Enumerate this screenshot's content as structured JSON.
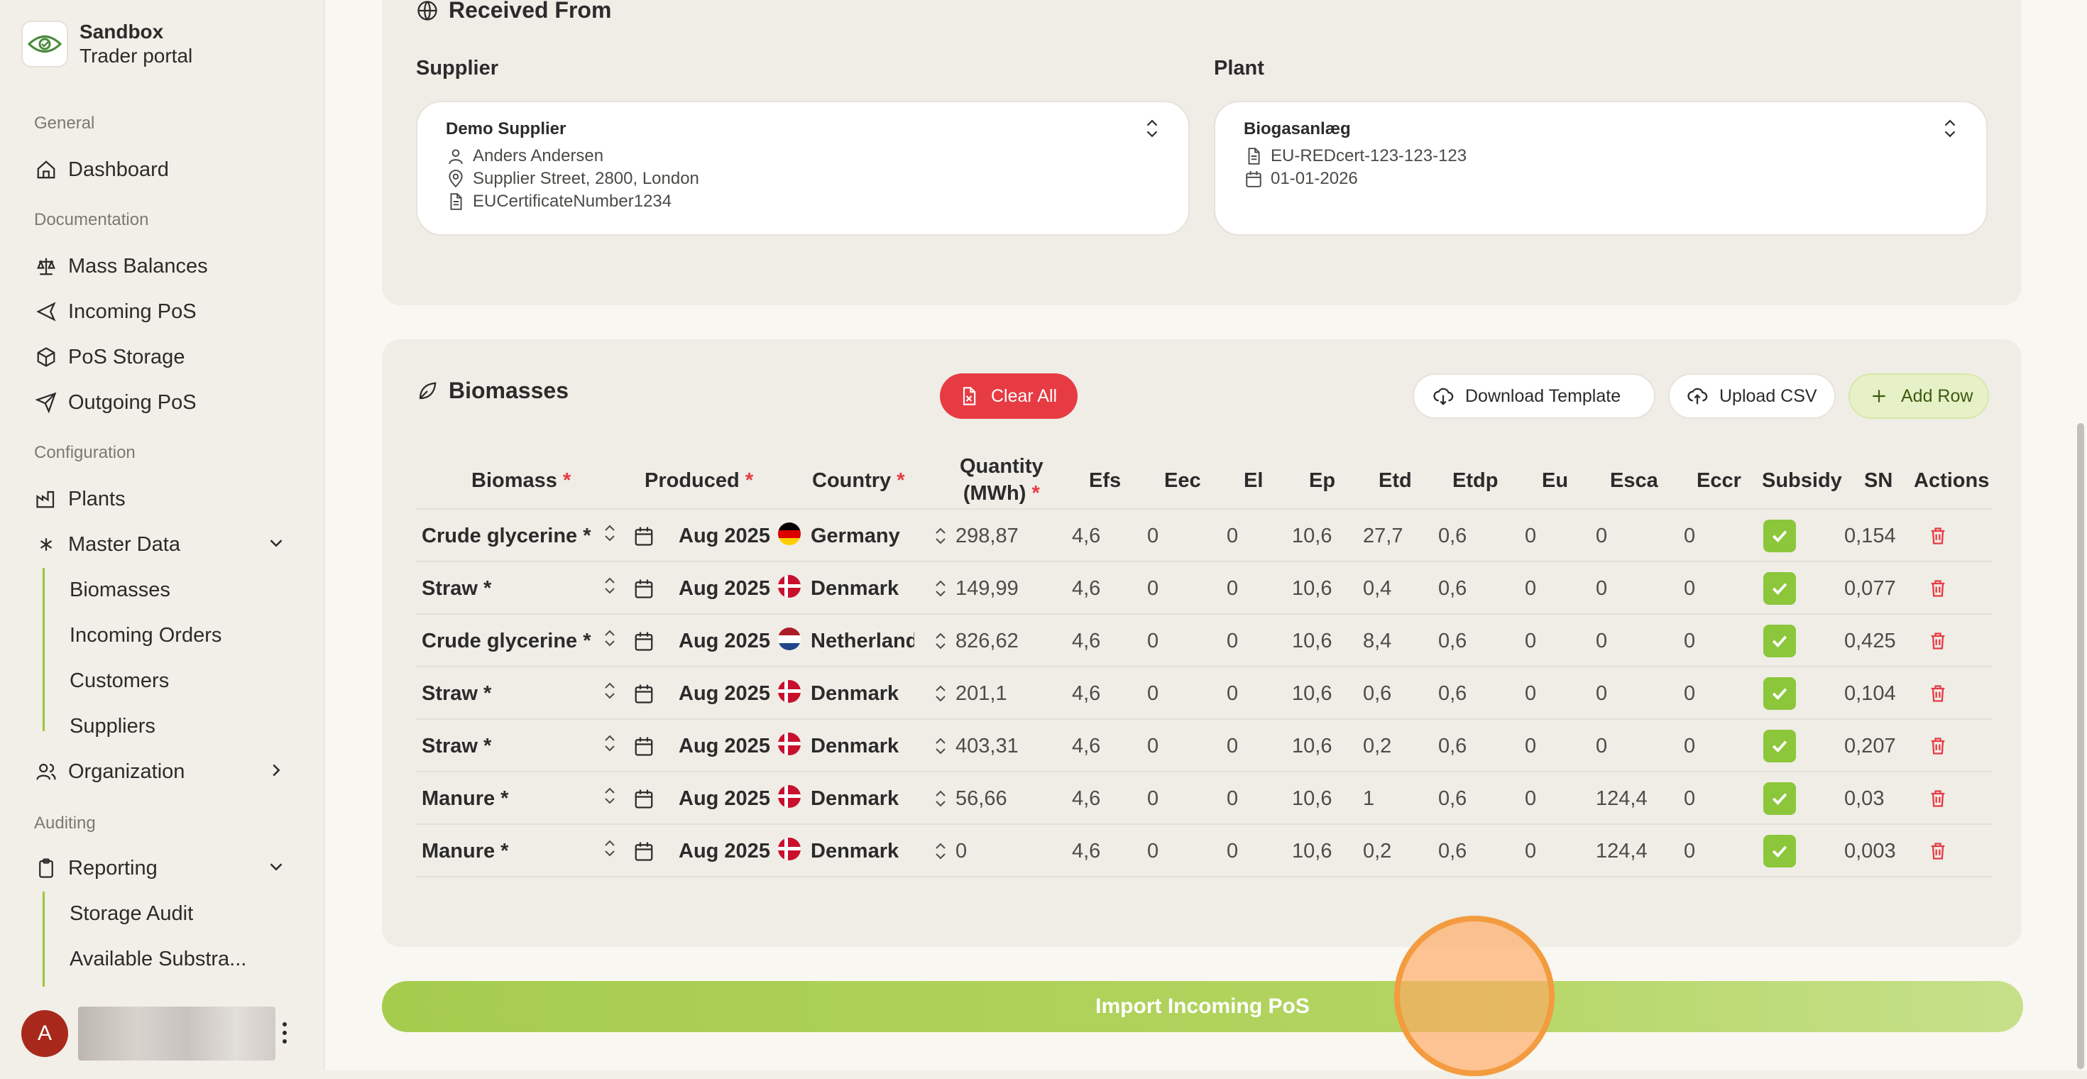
{
  "brand": {
    "name": "Sandbox",
    "subtitle": "Trader portal"
  },
  "sidebar": {
    "sections": {
      "general": "General",
      "documentation": "Documentation",
      "configuration": "Configuration",
      "auditing": "Auditing"
    },
    "items": {
      "dashboard": "Dashboard",
      "mass_balances": "Mass Balances",
      "incoming_pos": "Incoming PoS",
      "pos_storage": "PoS Storage",
      "outgoing_pos": "Outgoing PoS",
      "plants": "Plants",
      "master_data": "Master Data",
      "organization": "Organization",
      "reporting": "Reporting"
    },
    "master_data_children": [
      "Biomasses",
      "Incoming Orders",
      "Customers",
      "Suppliers"
    ],
    "reporting_children": [
      "Storage Audit",
      "Available Substra..."
    ],
    "user_initial": "A"
  },
  "received_from": {
    "title": "Received From",
    "supplier": {
      "label": "Supplier",
      "name": "Demo Supplier",
      "person": "Anders Andersen",
      "address": "Supplier Street, 2800, London",
      "certificate": "EUCertificateNumber1234"
    },
    "plant": {
      "label": "Plant",
      "name": "Biogasanlæg",
      "certificate": "EU-REDcert-123-123-123",
      "date": "01-01-2026"
    }
  },
  "biomasses": {
    "title": "Biomasses",
    "buttons": {
      "clear_all": "Clear All",
      "download_template": "Download Template",
      "upload_csv": "Upload CSV",
      "add_row": "Add Row"
    },
    "headers": {
      "biomass": "Biomass",
      "produced": "Produced",
      "country": "Country",
      "quantity_line1": "Quantity",
      "quantity_line2": "(MWh)",
      "efs": "Efs",
      "eec": "Eec",
      "el": "El",
      "ep": "Ep",
      "etd": "Etd",
      "etdp": "Etdp",
      "eu": "Eu",
      "esca": "Esca",
      "eccr": "Eccr",
      "subsidy": "Subsidy",
      "sn": "SN",
      "actions": "Actions"
    },
    "required_mark": "*",
    "rows": [
      {
        "biomass": "Crude glycerine *",
        "produced": "Aug 2025",
        "flag": "de",
        "country": "Germany",
        "quantity": "298,87",
        "efs": "4,6",
        "eec": "0",
        "el": "0",
        "ep": "10,6",
        "etd": "27,7",
        "etdp": "0,6",
        "eu": "0",
        "esca": "0",
        "eccr": "0",
        "subsidy": true,
        "sn": "0,154"
      },
      {
        "biomass": "Straw *",
        "produced": "Aug 2025",
        "flag": "dk",
        "country": "Denmark",
        "quantity": "149,99",
        "efs": "4,6",
        "eec": "0",
        "el": "0",
        "ep": "10,6",
        "etd": "0,4",
        "etdp": "0,6",
        "eu": "0",
        "esca": "0",
        "eccr": "0",
        "subsidy": true,
        "sn": "0,077"
      },
      {
        "biomass": "Crude glycerine *",
        "produced": "Aug 2025",
        "flag": "nl",
        "country": "Netherlands",
        "quantity": "826,62",
        "efs": "4,6",
        "eec": "0",
        "el": "0",
        "ep": "10,6",
        "etd": "8,4",
        "etdp": "0,6",
        "eu": "0",
        "esca": "0",
        "eccr": "0",
        "subsidy": true,
        "sn": "0,425"
      },
      {
        "biomass": "Straw *",
        "produced": "Aug 2025",
        "flag": "dk",
        "country": "Denmark",
        "quantity": "201,1",
        "efs": "4,6",
        "eec": "0",
        "el": "0",
        "ep": "10,6",
        "etd": "0,6",
        "etdp": "0,6",
        "eu": "0",
        "esca": "0",
        "eccr": "0",
        "subsidy": true,
        "sn": "0,104"
      },
      {
        "biomass": "Straw *",
        "produced": "Aug 2025",
        "flag": "dk",
        "country": "Denmark",
        "quantity": "403,31",
        "efs": "4,6",
        "eec": "0",
        "el": "0",
        "ep": "10,6",
        "etd": "0,2",
        "etdp": "0,6",
        "eu": "0",
        "esca": "0",
        "eccr": "0",
        "subsidy": true,
        "sn": "0,207"
      },
      {
        "biomass": "Manure *",
        "produced": "Aug 2025",
        "flag": "dk",
        "country": "Denmark",
        "quantity": "56,66",
        "efs": "4,6",
        "eec": "0",
        "el": "0",
        "ep": "10,6",
        "etd": "1",
        "etdp": "0,6",
        "eu": "0",
        "esca": "124,4",
        "eccr": "0",
        "subsidy": true,
        "sn": "0,03"
      },
      {
        "biomass": "Manure *",
        "produced": "Aug 2025",
        "flag": "dk",
        "country": "Denmark",
        "quantity": "0",
        "efs": "4,6",
        "eec": "0",
        "el": "0",
        "ep": "10,6",
        "etd": "0,2",
        "etdp": "0,6",
        "eu": "0",
        "esca": "124,4",
        "eccr": "0",
        "subsidy": true,
        "sn": "0,003"
      }
    ]
  },
  "import_button": "Import Incoming PoS",
  "colors": {
    "accent_green": "#8cc63b",
    "danger_red": "#e63b43",
    "import_green": "#a6cc4e"
  }
}
